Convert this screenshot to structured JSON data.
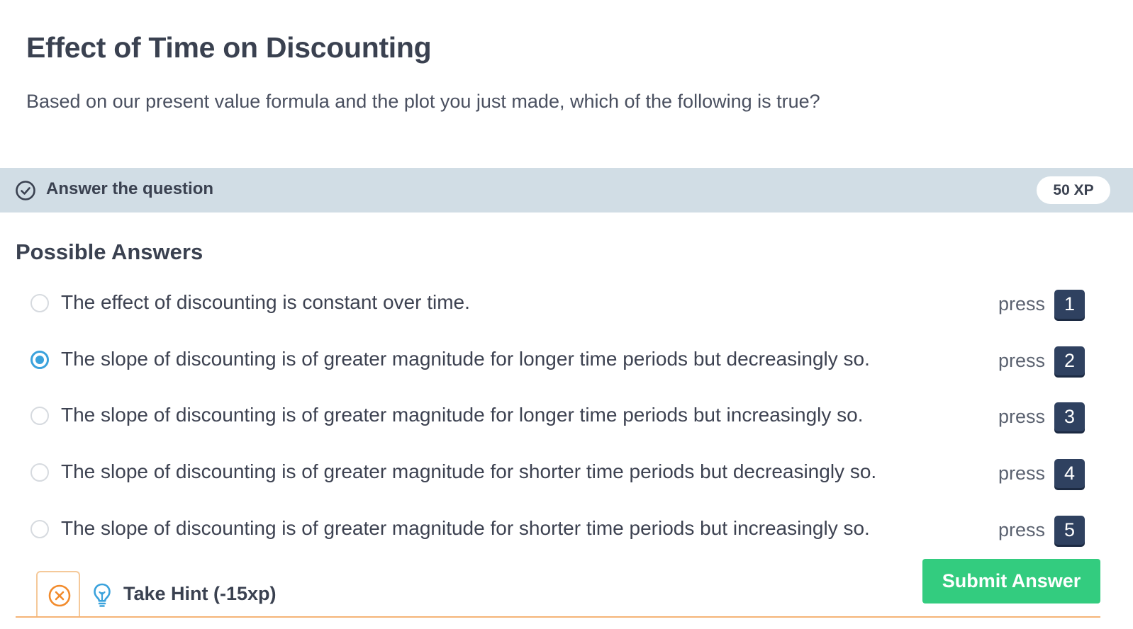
{
  "exercise": {
    "title": "Effect of Time on Discounting",
    "question": "Based on our present value formula and the plot you just made, which of the following is true?"
  },
  "task": {
    "label": "Answer the question",
    "xp": "50 XP"
  },
  "answers": {
    "heading": "Possible Answers",
    "press_label": "press",
    "selected_index": 1,
    "options": [
      {
        "text": "The effect of discounting is constant over time.",
        "key": "1"
      },
      {
        "text": "The slope of discounting is of greater magnitude for longer time periods but decreasingly so.",
        "key": "2"
      },
      {
        "text": "The slope of discounting is of greater magnitude for longer time periods but increasingly so.",
        "key": "3"
      },
      {
        "text": "The slope of discounting is of greater magnitude for shorter time periods but decreasingly so.",
        "key": "4"
      },
      {
        "text": "The slope of discounting is of greater magnitude for shorter time periods but increasingly so.",
        "key": "5"
      }
    ]
  },
  "hint": {
    "label": "Take Hint (-15xp)"
  },
  "submit": {
    "label": "Submit Answer"
  },
  "icons": {
    "task": "check-circle-icon",
    "hint_close": "close-circle-icon",
    "hint": "lightbulb-icon"
  },
  "colors": {
    "accent_selected": "#3aa2dc",
    "key_badge": "#2f4160",
    "submit": "#33cc7f",
    "hint_border": "#f5b477",
    "task_bar": "#d1dde5"
  }
}
